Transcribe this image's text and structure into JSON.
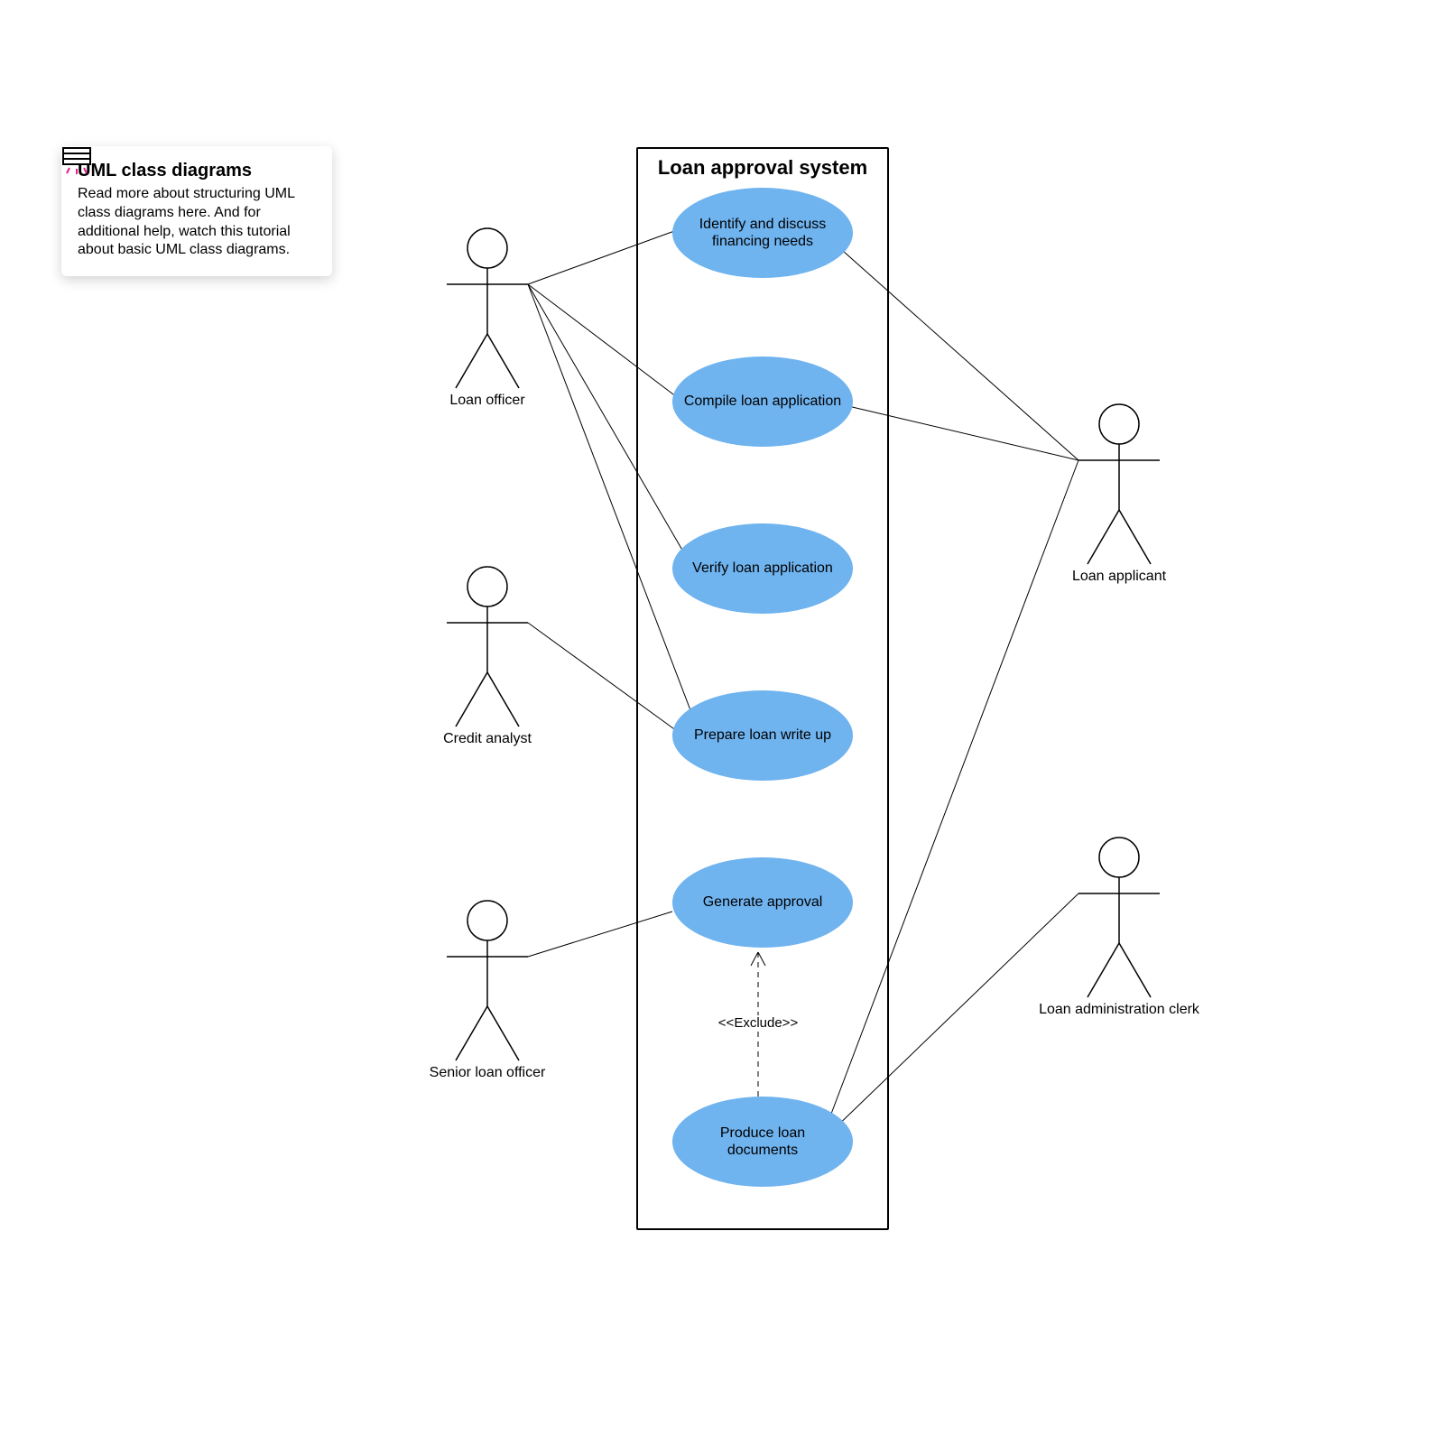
{
  "callout": {
    "title": "UML class diagrams",
    "body": "Read more about structuring UML class diagrams here. And for additional help, watch this tutorial about basic UML class diagrams."
  },
  "system": {
    "title": "Loan approval system"
  },
  "usecases": {
    "u1": "Identify and discuss financing needs",
    "u2": "Compile loan application",
    "u3": "Verify loan application",
    "u4": "Prepare loan write up",
    "u5": "Generate approval",
    "u6": "Produce loan documents"
  },
  "actors": {
    "loan_officer": "Loan officer",
    "credit_analyst": "Credit analyst",
    "senior_loan_officer": "Senior loan officer",
    "loan_applicant": "Loan applicant",
    "loan_admin_clerk": "Loan administration clerk"
  },
  "edge_labels": {
    "exclude": "<<Exclude>>"
  }
}
